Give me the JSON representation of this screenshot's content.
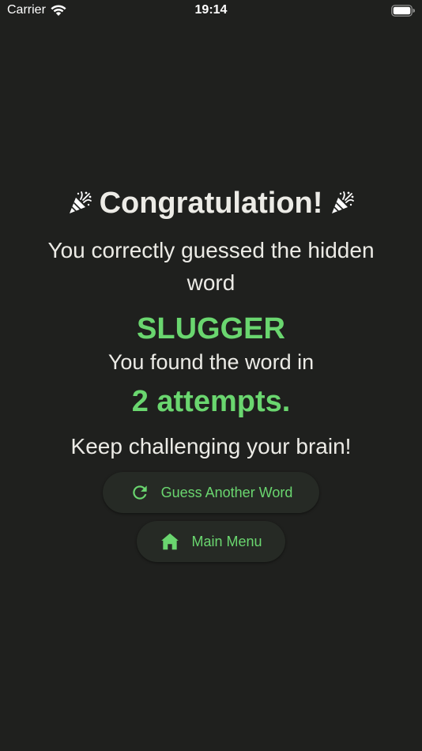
{
  "status_bar": {
    "carrier": "Carrier",
    "time": "19:14"
  },
  "main": {
    "title": "Congratulation!",
    "subtitle": "You correctly guessed the hidden word",
    "word": "SLUGGER",
    "found_text": "You found the word in",
    "attempts": "2 attempts.",
    "encouragement": "Keep challenging your brain!",
    "guess_button_label": "Guess Another Word",
    "menu_button_label": "Main Menu"
  },
  "colors": {
    "background": "#1f201e",
    "accent": "#6ad66f",
    "button_bg": "#262a25",
    "text": "#ecebe6"
  },
  "icons": {
    "left_title_icon": "party-popper-icon",
    "right_title_icon": "party-popper-icon",
    "guess_button_icon": "refresh-icon",
    "menu_button_icon": "home-icon"
  }
}
